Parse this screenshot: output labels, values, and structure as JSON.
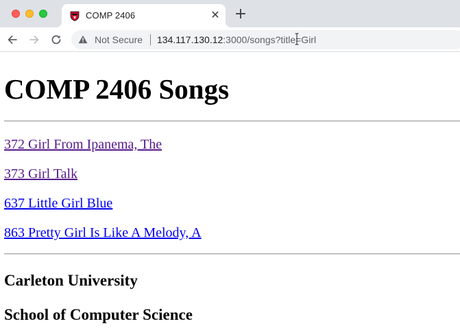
{
  "browser": {
    "tab": {
      "title": "COMP 2406",
      "close_glyph": "✕"
    },
    "new_tab_glyph": "+",
    "address_bar": {
      "security_label": "Not Secure",
      "host": "134.117.130.12",
      "rest": ":3000/songs?title=Girl"
    },
    "icons": {
      "back": "back-arrow-icon",
      "forward": "forward-arrow-icon",
      "reload": "reload-icon",
      "warning": "warning-triangle-icon",
      "favicon": "carleton-shield-icon"
    }
  },
  "page": {
    "heading": "COMP 2406 Songs",
    "songs": [
      {
        "label": "372 Girl From Ipanema, The",
        "visited": true
      },
      {
        "label": "373 Girl Talk",
        "visited": true
      },
      {
        "label": "637 Little Girl Blue",
        "visited": false
      },
      {
        "label": "863 Pretty Girl Is Like A Melody, A",
        "visited": false
      }
    ],
    "footer": {
      "university": "Carleton University",
      "school": "School of Computer Science"
    }
  },
  "colors": {
    "link_visited": "#551a8b",
    "link_unvisited": "#0000ee"
  }
}
